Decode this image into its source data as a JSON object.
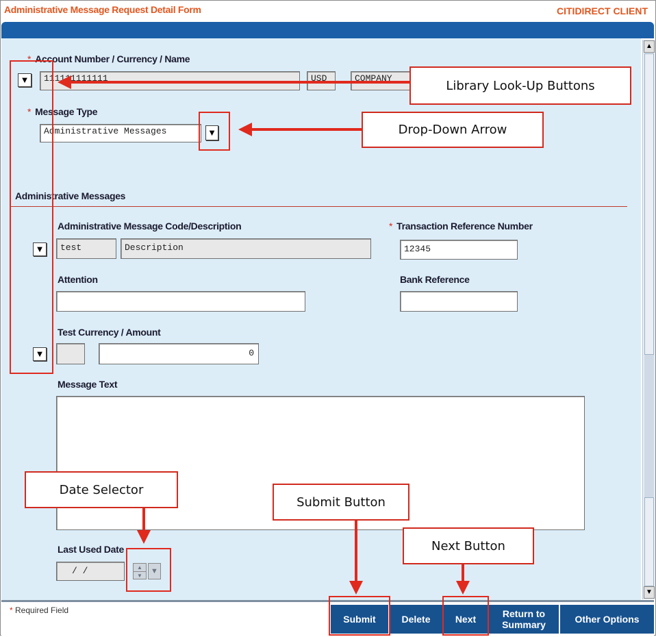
{
  "header": {
    "title": "Administrative Message Request Detail Form",
    "client": "CITIDIRECT CLIENT"
  },
  "account": {
    "label": "Account Number / Currency / Name",
    "number": "111111111111",
    "currency": "USD",
    "name": "COMPANY"
  },
  "message_type": {
    "label": "Message Type",
    "value": "Administrative Messages"
  },
  "section": {
    "title": "Administrative Messages"
  },
  "admin_code": {
    "label": "Administrative Message Code/Description",
    "code": "test",
    "description": "Description"
  },
  "txn_ref": {
    "label": "Transaction Reference Number",
    "value": "12345"
  },
  "attention": {
    "label": "Attention",
    "value": ""
  },
  "bank_ref": {
    "label": "Bank Reference",
    "value": ""
  },
  "test_currency": {
    "label": "Test Currency / Amount",
    "currency": "",
    "amount": "0"
  },
  "message_text": {
    "label": "Message Text",
    "value": ""
  },
  "last_used_date": {
    "label": "Last Used Date",
    "value": "/ /"
  },
  "footer": {
    "required_note": "Required Field",
    "required_marker": "*",
    "buttons": {
      "submit": "Submit",
      "delete": "Delete",
      "next": "Next",
      "return": "Return to Summary",
      "other": "Other Options"
    }
  },
  "callouts": {
    "library": "Library Look-Up Buttons",
    "dropdown": "Drop-Down Arrow",
    "date": "Date Selector",
    "submit": "Submit Button",
    "next": "Next Button"
  },
  "icons": {
    "lookup": "▼",
    "dropdown": "▼",
    "scroll_up": "▲",
    "scroll_down": "▼"
  },
  "colors": {
    "accent": "#e2561f",
    "header_bar": "#1a5fa8",
    "panel": "#dcedf8",
    "button": "#17528f",
    "annotation": "#e02a1e"
  }
}
